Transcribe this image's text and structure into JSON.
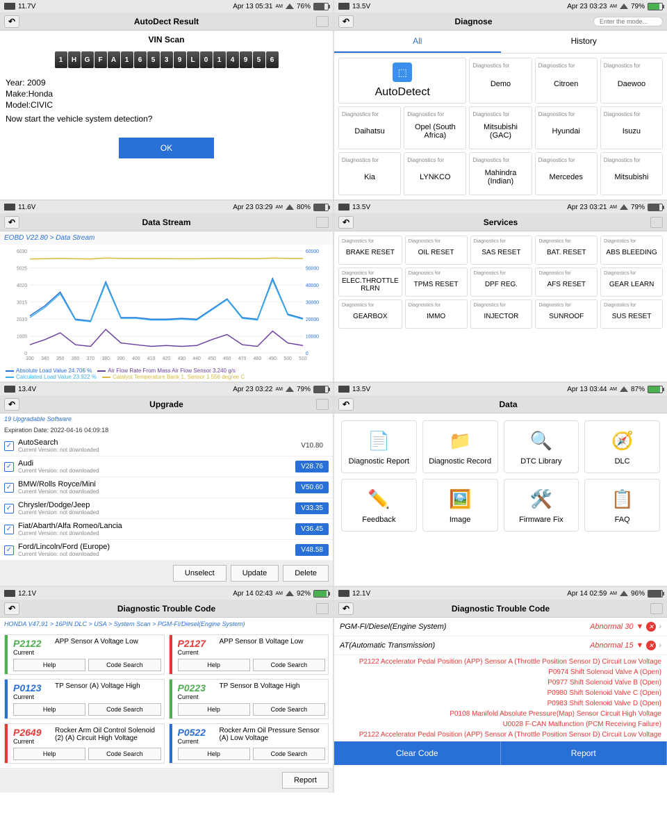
{
  "p1": {
    "status": {
      "voltage": "11.7V",
      "datetime": "Apr 13 05:31",
      "ampm": "AM",
      "battery": "76%"
    },
    "title": "AutoDect Result",
    "vin_title": "VIN Scan",
    "vin": [
      "1",
      "H",
      "G",
      "F",
      "A",
      "1",
      "6",
      "5",
      "3",
      "9",
      "L",
      "0",
      "1",
      "4",
      "9",
      "5",
      "6"
    ],
    "year_label": "Year:",
    "year": "2009",
    "make_label": "Make:",
    "make": "Honda",
    "model_label": "Model:",
    "model": "CIVIC",
    "prompt": "Now start the vehicle system detection?",
    "ok": "OK"
  },
  "p2": {
    "status": {
      "voltage": "13.5V",
      "datetime": "Apr 23 03:23",
      "ampm": "AM",
      "battery": "79%"
    },
    "title": "Diagnose",
    "search_placeholder": "Enter the mode...",
    "tabs": [
      "All",
      "History"
    ],
    "autodetect": "AutoDetect",
    "diag_label": "Diagnostics for",
    "brands": [
      "Demo",
      "Citroen",
      "Daewoo",
      "Daihatsu",
      "Opel (South Africa)",
      "Mitsubishi (GAC)",
      "Hyundai",
      "Isuzu",
      "Kia",
      "LYNKCO",
      "Mahindra (Indian)",
      "Mercedes",
      "Mitsubishi"
    ]
  },
  "p3": {
    "status": {
      "voltage": "11.6V",
      "datetime": "Apr 23 03:29",
      "ampm": "AM",
      "battery": "80%"
    },
    "title": "Data Stream",
    "breadcrumb": "EOBD V22.80 > Data Stream",
    "legend": [
      {
        "color": "#2970d6",
        "text": "Absolute Load Value 24.706 %"
      },
      {
        "color": "#6b3fa0",
        "text": "Air Flow Rate From Mass Air Flow Sensor 3.240 g/s"
      },
      {
        "color": "#3bb0ed",
        "text": "Calculated Load Value 23.922 %"
      },
      {
        "color": "#d9b93b",
        "text": "Catalyst Temperature Bank 1, Sensor 1 556 degree C"
      }
    ]
  },
  "p4": {
    "status": {
      "voltage": "13.5V",
      "datetime": "Apr 23 03:21",
      "ampm": "AM",
      "battery": "79%"
    },
    "title": "Services",
    "diag_label": "Diagnostics for",
    "services": [
      "BRAKE RESET",
      "OIL RESET",
      "SAS RESET",
      "BAT. RESET",
      "ABS BLEEDING",
      "ELEC.THROTTLE RLRN",
      "TPMS RESET",
      "DPF REG.",
      "AFS RESET",
      "GEAR LEARN",
      "GEARBOX",
      "IMMO",
      "INJECTOR",
      "SUNROOF",
      "SUS RESET"
    ]
  },
  "p5": {
    "status": {
      "voltage": "13.4V",
      "datetime": "Apr 23 03:22",
      "ampm": "AM",
      "battery": "79%"
    },
    "title": "Upgrade",
    "info1": "19 Upgradable Software",
    "info2": "Expiration Date: 2022-04-16 04:09:18",
    "ver_text": "Current Version: not downloaded",
    "items": [
      {
        "name": "AutoSearch",
        "ver": "V10.80",
        "plain": true
      },
      {
        "name": "Audi",
        "ver": "V28.76"
      },
      {
        "name": "BMW/Rolls Royce/Mini",
        "ver": "V50.60"
      },
      {
        "name": "Chrysler/Dodge/Jeep",
        "ver": "V33.35"
      },
      {
        "name": "Fiat/Abarth/Alfa Romeo/Lancia",
        "ver": "V36.45"
      },
      {
        "name": "Ford/Lincoln/Ford (Europe)",
        "ver": "V48.58"
      }
    ],
    "actions": [
      "Unselect",
      "Update",
      "Delete"
    ]
  },
  "p6": {
    "status": {
      "voltage": "13.5V",
      "datetime": "Apr 13 03:44",
      "ampm": "AM",
      "battery": "87%"
    },
    "title": "Data",
    "items": [
      {
        "icon": "📄",
        "label": "Diagnostic Report"
      },
      {
        "icon": "📁",
        "label": "Diagnostic Record"
      },
      {
        "icon": "🔍",
        "label": "DTC Library"
      },
      {
        "icon": "🧭",
        "label": "DLC"
      },
      {
        "icon": "✏️",
        "label": "Feedback"
      },
      {
        "icon": "🖼️",
        "label": "Image"
      },
      {
        "icon": "🛠️",
        "label": "Firmware Fix"
      },
      {
        "icon": "📋",
        "label": "FAQ"
      }
    ]
  },
  "p7": {
    "status": {
      "voltage": "12.1V",
      "datetime": "Apr 14 02:43",
      "ampm": "AM",
      "battery": "92%"
    },
    "title": "Diagnostic Trouble Code",
    "breadcrumb": "HONDA V47.91 > 16PIN DLC > USA > System Scan > PGM-FI/Diesel(Engine System)",
    "help": "Help",
    "search": "Code Search",
    "current": "Current",
    "codes": [
      {
        "code": "P2122",
        "desc": "APP Sensor A Voltage Low",
        "color": "#4caf50"
      },
      {
        "code": "P2127",
        "desc": "APP Sensor B Voltage Low",
        "color": "#e53935"
      },
      {
        "code": "P0123",
        "desc": "TP Sensor (A) Voltage High",
        "color": "#2970d6"
      },
      {
        "code": "P0223",
        "desc": "TP Sensor B Voltage High",
        "color": "#4caf50"
      },
      {
        "code": "P2649",
        "desc": "Rocker Arm Oil Control Solenoid (2) (A) Circuit High Voltage",
        "color": "#e53935"
      },
      {
        "code": "P0522",
        "desc": "Rocker Arm Oil Pressure Sensor (A) Low Voltage",
        "color": "#2970d6"
      }
    ],
    "report": "Report"
  },
  "p8": {
    "status": {
      "voltage": "12.1V",
      "datetime": "Apr 14 02:59",
      "ampm": "AM",
      "battery": "96%"
    },
    "title": "Diagnostic Trouble Code",
    "systems": [
      {
        "name": "PGM-FI/Diesel(Engine System)",
        "status": "Abnormal 30"
      },
      {
        "name": "AT(Automatic Transmission)",
        "status": "Abnormal 15"
      }
    ],
    "lines": [
      "P2122 Accelerator Pedal Position (APP) Sensor A (Throttle Position Sensor D) Circuit Low Voltage",
      "P0974 Shift Solenoid Valve A (Open)",
      "P0977 Shift Solenoid Valve B (Open)",
      "P0980 Shift Solenoid Valve C (Open)",
      "P0983 Shift Solenoid Valve D (Open)",
      "P0108 Manifold Absolute Pressure(Map) Sensor Circuit High Voltage",
      "U0028 F-CAN Malfunction (PCM Receiving Failure)",
      "P2122 Accelerator Pedal Position (APP) Sensor A (Throttle Position Sensor D) Circuit Low Voltage"
    ],
    "clear": "Clear Code",
    "report": "Report"
  },
  "chart_data": {
    "type": "line",
    "title": "Data Stream",
    "xlabel": "",
    "ylabel": "",
    "x": [
      330,
      340,
      350,
      360,
      370,
      380,
      390,
      400,
      410,
      420,
      430,
      440,
      450,
      460,
      470,
      480,
      490,
      500,
      510
    ],
    "y_left_ticks": [
      0,
      1005,
      2010,
      3015,
      4020,
      5025,
      6030
    ],
    "y_right_ticks": [
      0,
      10000,
      20000,
      30000,
      40000,
      50000,
      60000
    ],
    "series": [
      {
        "name": "Absolute Load Value 24.706 %",
        "color": "#2970d6",
        "values": [
          2200,
          2800,
          3600,
          2000,
          1900,
          4200,
          2100,
          2100,
          2000,
          2000,
          2050,
          2000,
          2600,
          3200,
          2100,
          2000,
          4400,
          2300,
          2050
        ]
      },
      {
        "name": "Air Flow Rate From Mass Air Flow Sensor 3.240 g/s",
        "color": "#6b3fa0",
        "values": [
          500,
          800,
          1200,
          500,
          400,
          1400,
          600,
          500,
          400,
          450,
          400,
          450,
          800,
          1100,
          500,
          400,
          1300,
          600,
          450
        ]
      },
      {
        "name": "Calculated Load Value 23.922 %",
        "color": "#3bb0ed",
        "values": [
          2100,
          2700,
          3500,
          1950,
          1850,
          4100,
          2050,
          2050,
          1950,
          1950,
          2000,
          1950,
          2550,
          3150,
          2050,
          1950,
          4300,
          2250,
          2000
        ]
      },
      {
        "name": "Catalyst Temperature Bank 1, Sensor 1 556 degree C",
        "color": "#d9b93b",
        "values": [
          5550,
          5560,
          5580,
          5560,
          5550,
          5600,
          5580,
          5570,
          5570,
          5565,
          5560,
          5560,
          5575,
          5585,
          5570,
          5565,
          5600,
          5580,
          5570
        ]
      }
    ]
  }
}
